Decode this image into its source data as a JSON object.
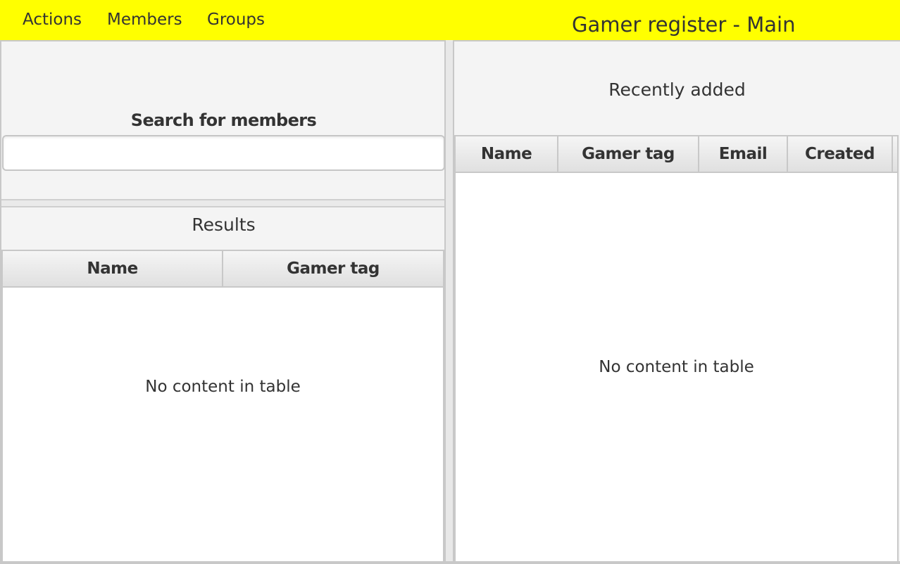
{
  "menu": {
    "items": [
      {
        "label": "Actions"
      },
      {
        "label": "Members"
      },
      {
        "label": "Groups"
      }
    ]
  },
  "window": {
    "title": "Gamer register - Main"
  },
  "colors": {
    "menubar": "#ffff00"
  },
  "search": {
    "heading": "Search for members",
    "value": "",
    "placeholder": ""
  },
  "results": {
    "title": "Results",
    "columns": [
      "Name",
      "Gamer tag"
    ],
    "empty_text": "No content in table"
  },
  "recent": {
    "title": "Recently added",
    "columns": [
      "Name",
      "Gamer tag",
      "Email",
      "Created"
    ],
    "empty_text": "No content in table"
  }
}
